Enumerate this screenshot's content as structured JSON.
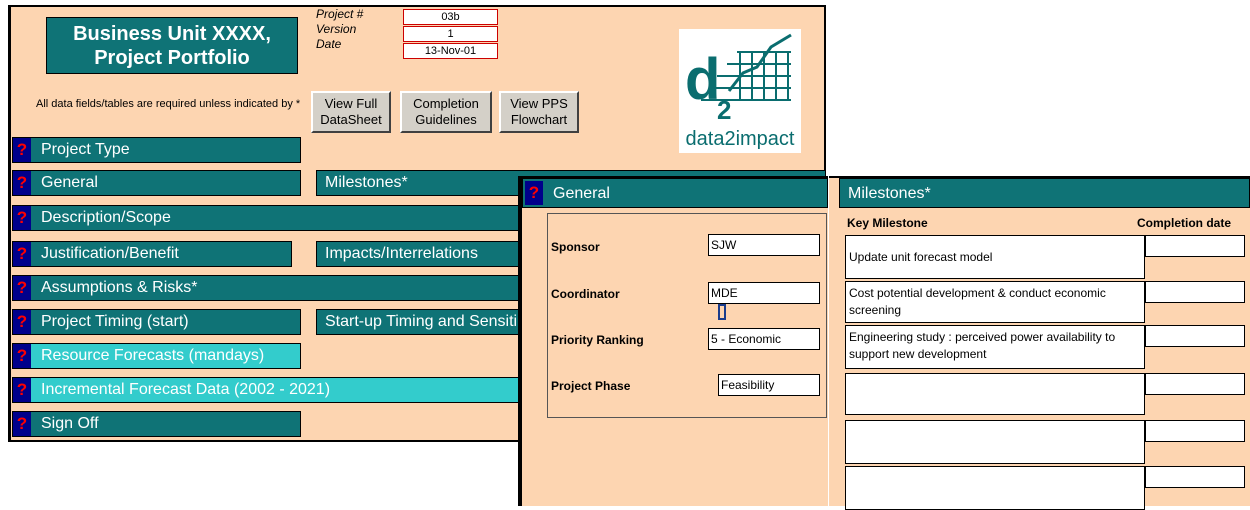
{
  "header": {
    "title_line1": "Business Unit XXXX,",
    "title_line2": "Project Portfolio",
    "project_label": "Project #",
    "project_value": "03b",
    "version_label": "Version",
    "version_value": "1",
    "date_label": "Date",
    "date_value": "13-Nov-01",
    "note": "All data fields/tables are required unless indicated by *"
  },
  "buttons": {
    "view_full": [
      "View Full",
      "DataSheet"
    ],
    "completion": [
      "Completion",
      "Guidelines"
    ],
    "view_pps": [
      "View PPS",
      "Flowchart"
    ]
  },
  "logo": {
    "text": "data2impact"
  },
  "help_mark": "?",
  "sections": {
    "project_type": "Project Type",
    "general": "General",
    "milestones": "Milestones*",
    "description": "Description/Scope",
    "justification": "Justification/Benefit",
    "impacts": "Impacts/Interrelations",
    "assumptions": "Assumptions & Risks*",
    "timing": "Project Timing (start)",
    "startup": "Start-up Timing and Sensiti",
    "resource": "Resource Forecasts (mandays)",
    "incremental": "Incremental Forecast Data (2002 - 2021)",
    "signoff": "Sign Off"
  },
  "general_panel": {
    "title": "General",
    "sponsor_label": "Sponsor",
    "sponsor_value": "SJW",
    "coordinator_label": "Coordinator",
    "coordinator_value": "MDE",
    "priority_label": "Priority Ranking",
    "priority_value": "5 - Economic",
    "phase_label": "Project Phase",
    "phase_value": "Feasibility"
  },
  "milestones_panel": {
    "title": "Milestones*",
    "col_key": "Key Milestone",
    "col_date": "Completion date",
    "rows": [
      {
        "milestone": "Update unit forecast model",
        "date": ""
      },
      {
        "milestone": "Cost potential development  & conduct economic screening",
        "date": ""
      },
      {
        "milestone": "Engineering study : perceived power availability to support new development",
        "date": ""
      },
      {
        "milestone": "",
        "date": ""
      },
      {
        "milestone": "",
        "date": ""
      },
      {
        "milestone": "",
        "date": ""
      }
    ]
  },
  "colors": {
    "background": "#fdd5b1",
    "section_dark": "#0f7376",
    "section_light": "#33cccc",
    "help_bg": "#00008b",
    "help_fg": "#ff0000"
  }
}
